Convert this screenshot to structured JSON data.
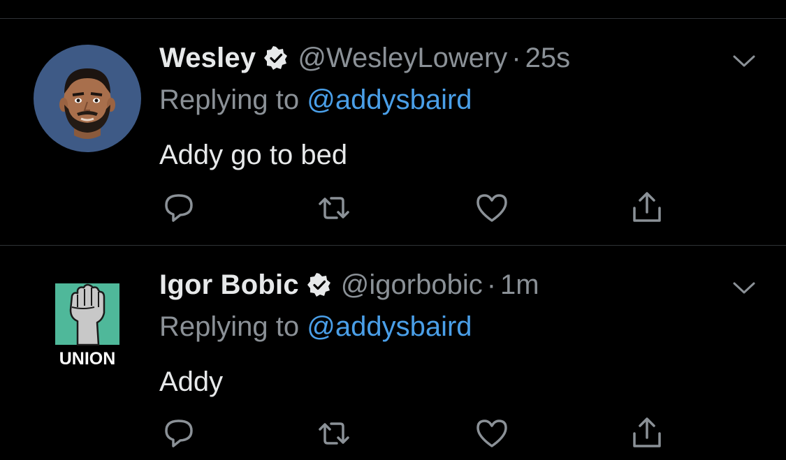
{
  "tweets": [
    {
      "name": "Wesley",
      "handle": "@WesleyLowery",
      "separator": "·",
      "time": "25s",
      "replying_label": "Replying to",
      "replying_to": "@addysbaird",
      "text": "Addy go to bed",
      "avatar_icon": "cartoon-man-avatar",
      "avatar_bg": "#3e5a86"
    },
    {
      "name": "Igor Bobic",
      "handle": "@igorbobic",
      "separator": "·",
      "time": "1m",
      "replying_label": "Replying to",
      "replying_to": "@addysbaird",
      "text": "Addy",
      "avatar_icon": "union-fist-avatar",
      "avatar_label": "UNION",
      "avatar_bg": "#4fb89a"
    }
  ],
  "colors": {
    "background": "#000000",
    "name": "#e7e9ea",
    "secondary": "#8b9197",
    "link": "#4a9fe8",
    "divider": "#2f3336"
  },
  "icons": [
    "verified-icon",
    "reply-icon",
    "retweet-icon",
    "like-icon",
    "share-icon",
    "chevron-down-icon"
  ]
}
